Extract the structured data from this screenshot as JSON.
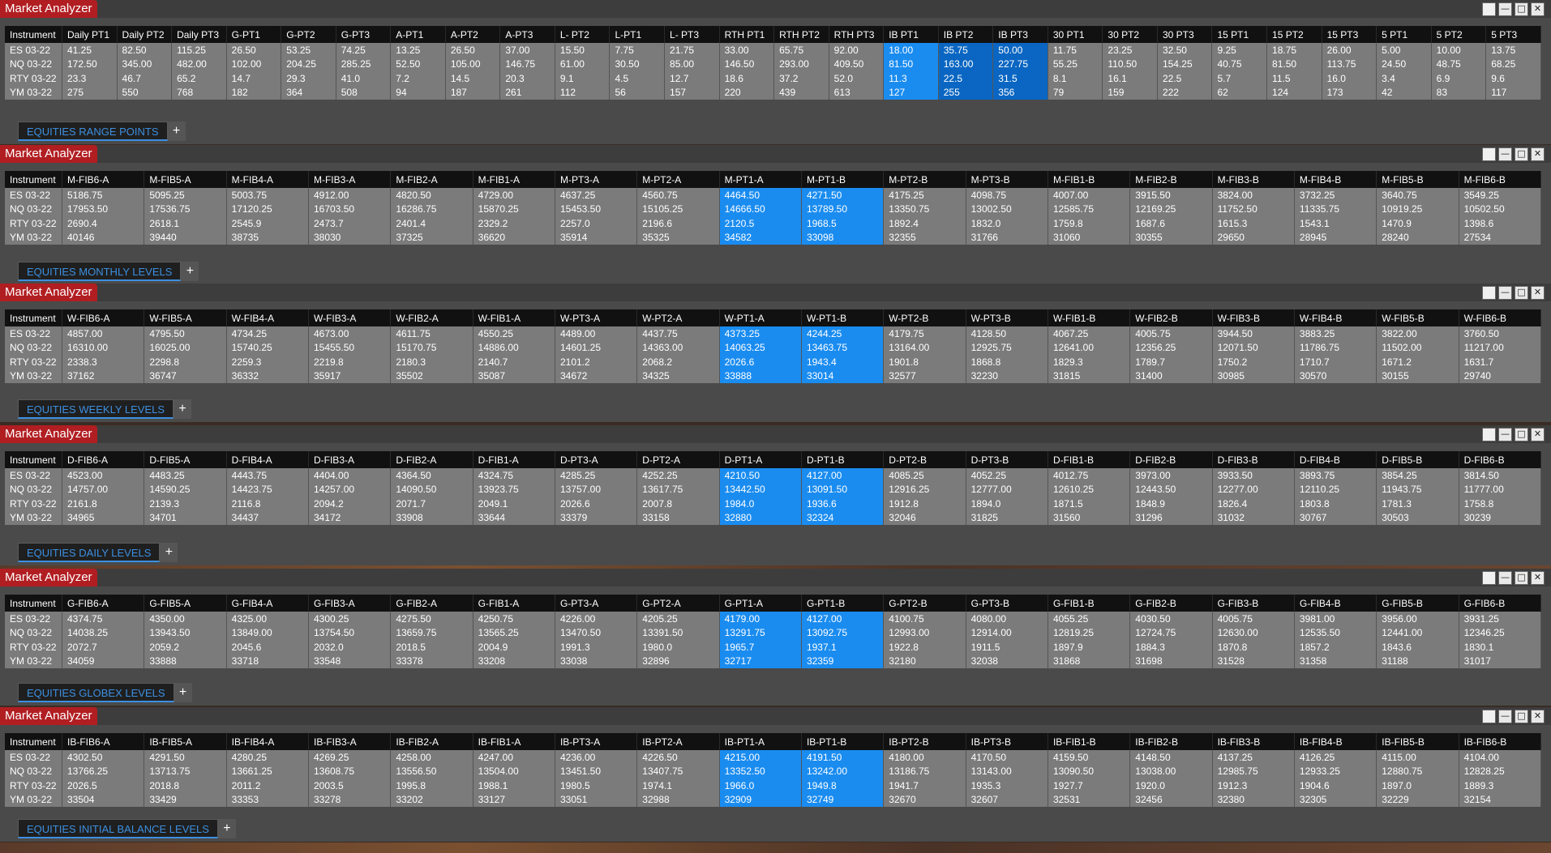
{
  "window_title": "Market Analyzer",
  "controls": {
    "minimize": "—",
    "restore": "□",
    "close": "✕"
  },
  "panels": [
    {
      "tab_label": "EQUITIES RANGE POINTS",
      "columns": [
        "Instrument",
        "Daily PT1",
        "Daily PT2",
        "Daily PT3",
        "G-PT1",
        "G-PT2",
        "G-PT3",
        "A-PT1",
        "A-PT2",
        "A-PT3",
        "L- PT2",
        "L-PT1",
        "L- PT3",
        "RTH PT1",
        "RTH PT2",
        "RTH PT3",
        "IB PT1",
        "IB PT2",
        "IB PT3",
        "30 PT1",
        "30 PT2",
        "30 PT3",
        "15 PT1",
        "15 PT2",
        "15 PT3",
        "5 PT1",
        "5 PT2",
        "5 PT3"
      ],
      "highlight_cols": [
        16,
        17,
        18
      ],
      "rows": [
        [
          "ES 03-22",
          "41.25",
          "82.50",
          "115.25",
          "26.50",
          "53.25",
          "74.25",
          "13.25",
          "26.50",
          "37.00",
          "15.50",
          "7.75",
          "21.75",
          "33.00",
          "65.75",
          "92.00",
          "18.00",
          "35.75",
          "50.00",
          "11.75",
          "23.25",
          "32.50",
          "9.25",
          "18.75",
          "26.00",
          "5.00",
          "10.00",
          "13.75"
        ],
        [
          "NQ 03-22",
          "172.50",
          "345.00",
          "482.00",
          "102.00",
          "204.25",
          "285.25",
          "52.50",
          "105.00",
          "146.75",
          "61.00",
          "30.50",
          "85.00",
          "146.50",
          "293.00",
          "409.50",
          "81.50",
          "163.00",
          "227.75",
          "55.25",
          "110.50",
          "154.25",
          "40.75",
          "81.50",
          "113.75",
          "24.50",
          "48.75",
          "68.25"
        ],
        [
          "RTY 03-22",
          "23.3",
          "46.7",
          "65.2",
          "14.7",
          "29.3",
          "41.0",
          "7.2",
          "14.5",
          "20.3",
          "9.1",
          "4.5",
          "12.7",
          "18.6",
          "37.2",
          "52.0",
          "11.3",
          "22.5",
          "31.5",
          "8.1",
          "16.1",
          "22.5",
          "5.7",
          "11.5",
          "16.0",
          "3.4",
          "6.9",
          "9.6"
        ],
        [
          "YM 03-22",
          "275",
          "550",
          "768",
          "182",
          "364",
          "508",
          "94",
          "187",
          "261",
          "112",
          "56",
          "157",
          "220",
          "439",
          "613",
          "127",
          "255",
          "356",
          "79",
          "159",
          "222",
          "62",
          "124",
          "173",
          "42",
          "83",
          "117"
        ]
      ]
    },
    {
      "tab_label": "EQUITIES MONTHLY LEVELS",
      "columns": [
        "Instrument",
        "M-FIB6-A",
        "M-FIB5-A",
        "M-FIB4-A",
        "M-FIB3-A",
        "M-FIB2-A",
        "M-FIB1-A",
        "M-PT3-A",
        "M-PT2-A",
        "M-PT1-A",
        "M-PT1-B",
        "M-PT2-B",
        "M-PT3-B",
        "M-FIB1-B",
        "M-FIB2-B",
        "M-FIB3-B",
        "M-FIB4-B",
        "M-FIB5-B",
        "M-FIB6-B"
      ],
      "highlight_cols": [
        9,
        10
      ],
      "rows": [
        [
          "ES 03-22",
          "5186.75",
          "5095.25",
          "5003.75",
          "4912.00",
          "4820.50",
          "4729.00",
          "4637.25",
          "4560.75",
          "4464.50",
          "4271.50",
          "4175.25",
          "4098.75",
          "4007.00",
          "3915.50",
          "3824.00",
          "3732.25",
          "3640.75",
          "3549.25"
        ],
        [
          "NQ 03-22",
          "17953.50",
          "17536.75",
          "17120.25",
          "16703.50",
          "16286.75",
          "15870.25",
          "15453.50",
          "15105.25",
          "14666.50",
          "13789.50",
          "13350.75",
          "13002.50",
          "12585.75",
          "12169.25",
          "11752.50",
          "11335.75",
          "10919.25",
          "10502.50"
        ],
        [
          "RTY 03-22",
          "2690.4",
          "2618.1",
          "2545.9",
          "2473.7",
          "2401.4",
          "2329.2",
          "2257.0",
          "2196.6",
          "2120.5",
          "1968.5",
          "1892.4",
          "1832.0",
          "1759.8",
          "1687.6",
          "1615.3",
          "1543.1",
          "1470.9",
          "1398.6"
        ],
        [
          "YM 03-22",
          "40146",
          "39440",
          "38735",
          "38030",
          "37325",
          "36620",
          "35914",
          "35325",
          "34582",
          "33098",
          "32355",
          "31766",
          "31060",
          "30355",
          "29650",
          "28945",
          "28240",
          "27534"
        ]
      ]
    },
    {
      "tab_label": "EQUITIES WEEKLY LEVELS",
      "columns": [
        "Instrument",
        "W-FIB6-A",
        "W-FIB5-A",
        "W-FIB4-A",
        "W-FIB3-A",
        "W-FIB2-A",
        "W-FIB1-A",
        "W-PT3-A",
        "W-PT2-A",
        "W-PT1-A",
        "W-PT1-B",
        "W-PT2-B",
        "W-PT3-B",
        "W-FIB1-B",
        "W-FIB2-B",
        "W-FIB3-B",
        "W-FIB4-B",
        "W-FIB5-B",
        "W-FIB6-B"
      ],
      "highlight_cols": [
        9,
        10
      ],
      "rows": [
        [
          "ES 03-22",
          "4857.00",
          "4795.50",
          "4734.25",
          "4673.00",
          "4611.75",
          "4550.25",
          "4489.00",
          "4437.75",
          "4373.25",
          "4244.25",
          "4179.75",
          "4128.50",
          "4067.25",
          "4005.75",
          "3944.50",
          "3883.25",
          "3822.00",
          "3760.50"
        ],
        [
          "NQ 03-22",
          "16310.00",
          "16025.00",
          "15740.25",
          "15455.50",
          "15170.75",
          "14886.00",
          "14601.25",
          "14363.00",
          "14063.25",
          "13463.75",
          "13164.00",
          "12925.75",
          "12641.00",
          "12356.25",
          "12071.50",
          "11786.75",
          "11502.00",
          "11217.00"
        ],
        [
          "RTY 03-22",
          "2338.3",
          "2298.8",
          "2259.3",
          "2219.8",
          "2180.3",
          "2140.7",
          "2101.2",
          "2068.2",
          "2026.6",
          "1943.4",
          "1901.8",
          "1868.8",
          "1829.3",
          "1789.7",
          "1750.2",
          "1710.7",
          "1671.2",
          "1631.7"
        ],
        [
          "YM 03-22",
          "37162",
          "36747",
          "36332",
          "35917",
          "35502",
          "35087",
          "34672",
          "34325",
          "33888",
          "33014",
          "32577",
          "32230",
          "31815",
          "31400",
          "30985",
          "30570",
          "30155",
          "29740"
        ]
      ]
    },
    {
      "tab_label": "EQUITIES DAILY LEVELS",
      "columns": [
        "Instrument",
        "D-FIB6-A",
        "D-FIB5-A",
        "D-FIB4-A",
        "D-FIB3-A",
        "D-FIB2-A",
        "D-FIB1-A",
        "D-PT3-A",
        "D-PT2-A",
        "D-PT1-A",
        "D-PT1-B",
        "D-PT2-B",
        "D-PT3-B",
        "D-FIB1-B",
        "D-FIB2-B",
        "D-FIB3-B",
        "D-FIB4-B",
        "D-FIB5-B",
        "D-FIB6-B"
      ],
      "highlight_cols": [
        9,
        10
      ],
      "rows": [
        [
          "ES 03-22",
          "4523.00",
          "4483.25",
          "4443.75",
          "4404.00",
          "4364.50",
          "4324.75",
          "4285.25",
          "4252.25",
          "4210.50",
          "4127.00",
          "4085.25",
          "4052.25",
          "4012.75",
          "3973.00",
          "3933.50",
          "3893.75",
          "3854.25",
          "3814.50"
        ],
        [
          "NQ 03-22",
          "14757.00",
          "14590.25",
          "14423.75",
          "14257.00",
          "14090.50",
          "13923.75",
          "13757.00",
          "13617.75",
          "13442.50",
          "13091.50",
          "12916.25",
          "12777.00",
          "12610.25",
          "12443.50",
          "12277.00",
          "12110.25",
          "11943.75",
          "11777.00"
        ],
        [
          "RTY 03-22",
          "2161.8",
          "2139.3",
          "2116.8",
          "2094.2",
          "2071.7",
          "2049.1",
          "2026.6",
          "2007.8",
          "1984.0",
          "1936.6",
          "1912.8",
          "1894.0",
          "1871.5",
          "1848.9",
          "1826.4",
          "1803.8",
          "1781.3",
          "1758.8"
        ],
        [
          "YM 03-22",
          "34965",
          "34701",
          "34437",
          "34172",
          "33908",
          "33644",
          "33379",
          "33158",
          "32880",
          "32324",
          "32046",
          "31825",
          "31560",
          "31296",
          "31032",
          "30767",
          "30503",
          "30239"
        ]
      ]
    },
    {
      "tab_label": "EQUITIES GLOBEX LEVELS",
      "columns": [
        "Instrument",
        "G-FIB6-A",
        "G-FIB5-A",
        "G-FIB4-A",
        "G-FIB3-A",
        "G-FIB2-A",
        "G-FIB1-A",
        "G-PT3-A",
        "G-PT2-A",
        "G-PT1-A",
        "G-PT1-B",
        "G-PT2-B",
        "G-PT3-B",
        "G-FIB1-B",
        "G-FIB2-B",
        "G-FIB3-B",
        "G-FIB4-B",
        "G-FIB5-B",
        "G-FIB6-B"
      ],
      "highlight_cols": [
        9,
        10
      ],
      "rows": [
        [
          "ES 03-22",
          "4374.75",
          "4350.00",
          "4325.00",
          "4300.25",
          "4275.50",
          "4250.75",
          "4226.00",
          "4205.25",
          "4179.00",
          "4127.00",
          "4100.75",
          "4080.00",
          "4055.25",
          "4030.50",
          "4005.75",
          "3981.00",
          "3956.00",
          "3931.25"
        ],
        [
          "NQ 03-22",
          "14038.25",
          "13943.50",
          "13849.00",
          "13754.50",
          "13659.75",
          "13565.25",
          "13470.50",
          "13391.50",
          "13291.75",
          "13092.75",
          "12993.00",
          "12914.00",
          "12819.25",
          "12724.75",
          "12630.00",
          "12535.50",
          "12441.00",
          "12346.25"
        ],
        [
          "RTY 03-22",
          "2072.7",
          "2059.2",
          "2045.6",
          "2032.0",
          "2018.5",
          "2004.9",
          "1991.3",
          "1980.0",
          "1965.7",
          "1937.1",
          "1922.8",
          "1911.5",
          "1897.9",
          "1884.3",
          "1870.8",
          "1857.2",
          "1843.6",
          "1830.1"
        ],
        [
          "YM 03-22",
          "34059",
          "33888",
          "33718",
          "33548",
          "33378",
          "33208",
          "33038",
          "32896",
          "32717",
          "32359",
          "32180",
          "32038",
          "31868",
          "31698",
          "31528",
          "31358",
          "31188",
          "31017"
        ]
      ]
    },
    {
      "tab_label": "EQUITIES INITIAL BALANCE LEVELS",
      "columns": [
        "Instrument",
        "IB-FIB6-A",
        "IB-FIB5-A",
        "IB-FIB4-A",
        "IB-FIB3-A",
        "IB-FIB2-A",
        "IB-FIB1-A",
        "IB-PT3-A",
        "IB-PT2-A",
        "IB-PT1-A",
        "IB-PT1-B",
        "IB-PT2-B",
        "IB-PT3-B",
        "IB-FIB1-B",
        "IB-FIB2-B",
        "IB-FIB3-B",
        "IB-FIB4-B",
        "IB-FIB5-B",
        "IB-FIB6-B"
      ],
      "highlight_cols": [
        9,
        10
      ],
      "rows": [
        [
          "ES 03-22",
          "4302.50",
          "4291.50",
          "4280.25",
          "4269.25",
          "4258.00",
          "4247.00",
          "4236.00",
          "4226.50",
          "4215.00",
          "4191.50",
          "4180.00",
          "4170.50",
          "4159.50",
          "4148.50",
          "4137.25",
          "4126.25",
          "4115.00",
          "4104.00"
        ],
        [
          "NQ 03-22",
          "13766.25",
          "13713.75",
          "13661.25",
          "13608.75",
          "13556.50",
          "13504.00",
          "13451.50",
          "13407.75",
          "13352.50",
          "13242.00",
          "13186.75",
          "13143.00",
          "13090.50",
          "13038.00",
          "12985.75",
          "12933.25",
          "12880.75",
          "12828.25"
        ],
        [
          "RTY 03-22",
          "2026.5",
          "2018.8",
          "2011.2",
          "2003.5",
          "1995.8",
          "1988.1",
          "1980.5",
          "1974.1",
          "1966.0",
          "1949.8",
          "1941.7",
          "1935.3",
          "1927.7",
          "1920.0",
          "1912.3",
          "1904.6",
          "1897.0",
          "1889.3"
        ],
        [
          "YM 03-22",
          "33504",
          "33429",
          "33353",
          "33278",
          "33202",
          "33127",
          "33051",
          "32988",
          "32909",
          "32749",
          "32670",
          "32607",
          "32531",
          "32456",
          "32380",
          "32305",
          "32229",
          "32154"
        ]
      ]
    }
  ]
}
